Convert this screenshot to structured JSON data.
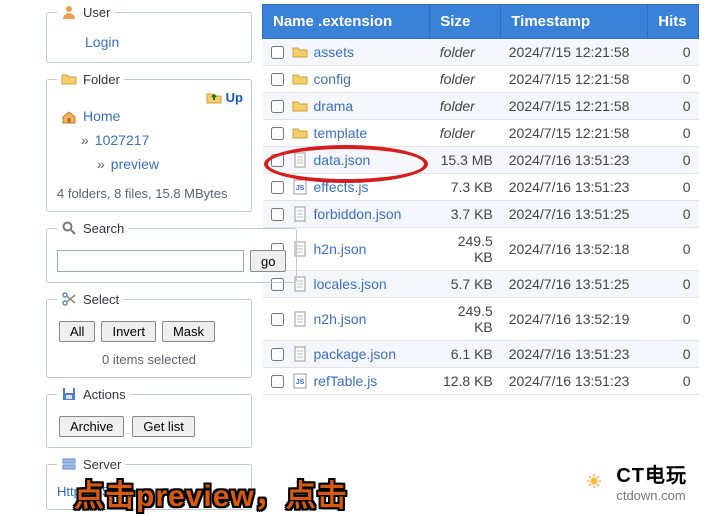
{
  "sidebar": {
    "user": {
      "legend": "User",
      "login": "Login"
    },
    "folder": {
      "legend": "Folder",
      "up": "Up",
      "home": "Home",
      "l1": "1027217",
      "l2": "preview",
      "stats": "4 folders, 8 files, 15.8 MBytes"
    },
    "search": {
      "legend": "Search",
      "go": "go",
      "value": ""
    },
    "select": {
      "legend": "Select",
      "all": "All",
      "invert": "Invert",
      "mask": "Mask",
      "status": "0 items selected"
    },
    "actions": {
      "legend": "Actions",
      "archive": "Archive",
      "getlist": "Get list"
    },
    "server": {
      "legend": "Server",
      "text": "HttpFileSe"
    }
  },
  "table": {
    "headers": {
      "name": "Name .extension",
      "size": "Size",
      "ts": "Timestamp",
      "hits": "Hits"
    },
    "rows": [
      {
        "type": "folder",
        "name": "assets",
        "size": "folder",
        "ts": "2024/7/15 12:21:58",
        "hits": "0"
      },
      {
        "type": "folder",
        "name": "config",
        "size": "folder",
        "ts": "2024/7/15 12:21:58",
        "hits": "0"
      },
      {
        "type": "folder",
        "name": "drama",
        "size": "folder",
        "ts": "2024/7/15 12:21:58",
        "hits": "0"
      },
      {
        "type": "folder",
        "name": "template",
        "size": "folder",
        "ts": "2024/7/15 12:21:58",
        "hits": "0"
      },
      {
        "type": "file",
        "name": "data.json",
        "size": "15.3 MB",
        "ts": "2024/7/16 13:51:23",
        "hits": "0"
      },
      {
        "type": "js",
        "name": "effects.js",
        "size": "7.3 KB",
        "ts": "2024/7/16 13:51:23",
        "hits": "0"
      },
      {
        "type": "file",
        "name": "forbiddon.json",
        "size": "3.7 KB",
        "ts": "2024/7/16 13:51:25",
        "hits": "0"
      },
      {
        "type": "file",
        "name": "h2n.json",
        "size": "249.5 KB",
        "ts": "2024/7/16 13:52:18",
        "hits": "0"
      },
      {
        "type": "file",
        "name": "locales.json",
        "size": "5.7 KB",
        "ts": "2024/7/16 13:51:25",
        "hits": "0"
      },
      {
        "type": "file",
        "name": "n2h.json",
        "size": "249.5 KB",
        "ts": "2024/7/16 13:52:19",
        "hits": "0"
      },
      {
        "type": "file",
        "name": "package.json",
        "size": "6.1 KB",
        "ts": "2024/7/16 13:51:23",
        "hits": "0"
      },
      {
        "type": "js",
        "name": "refTable.js",
        "size": "12.8 KB",
        "ts": "2024/7/16 13:51:23",
        "hits": "0"
      }
    ]
  },
  "overlay": {
    "caption": "点击preview，点击"
  },
  "watermark": {
    "title": "CT电玩",
    "sub": "ctdown.com"
  }
}
